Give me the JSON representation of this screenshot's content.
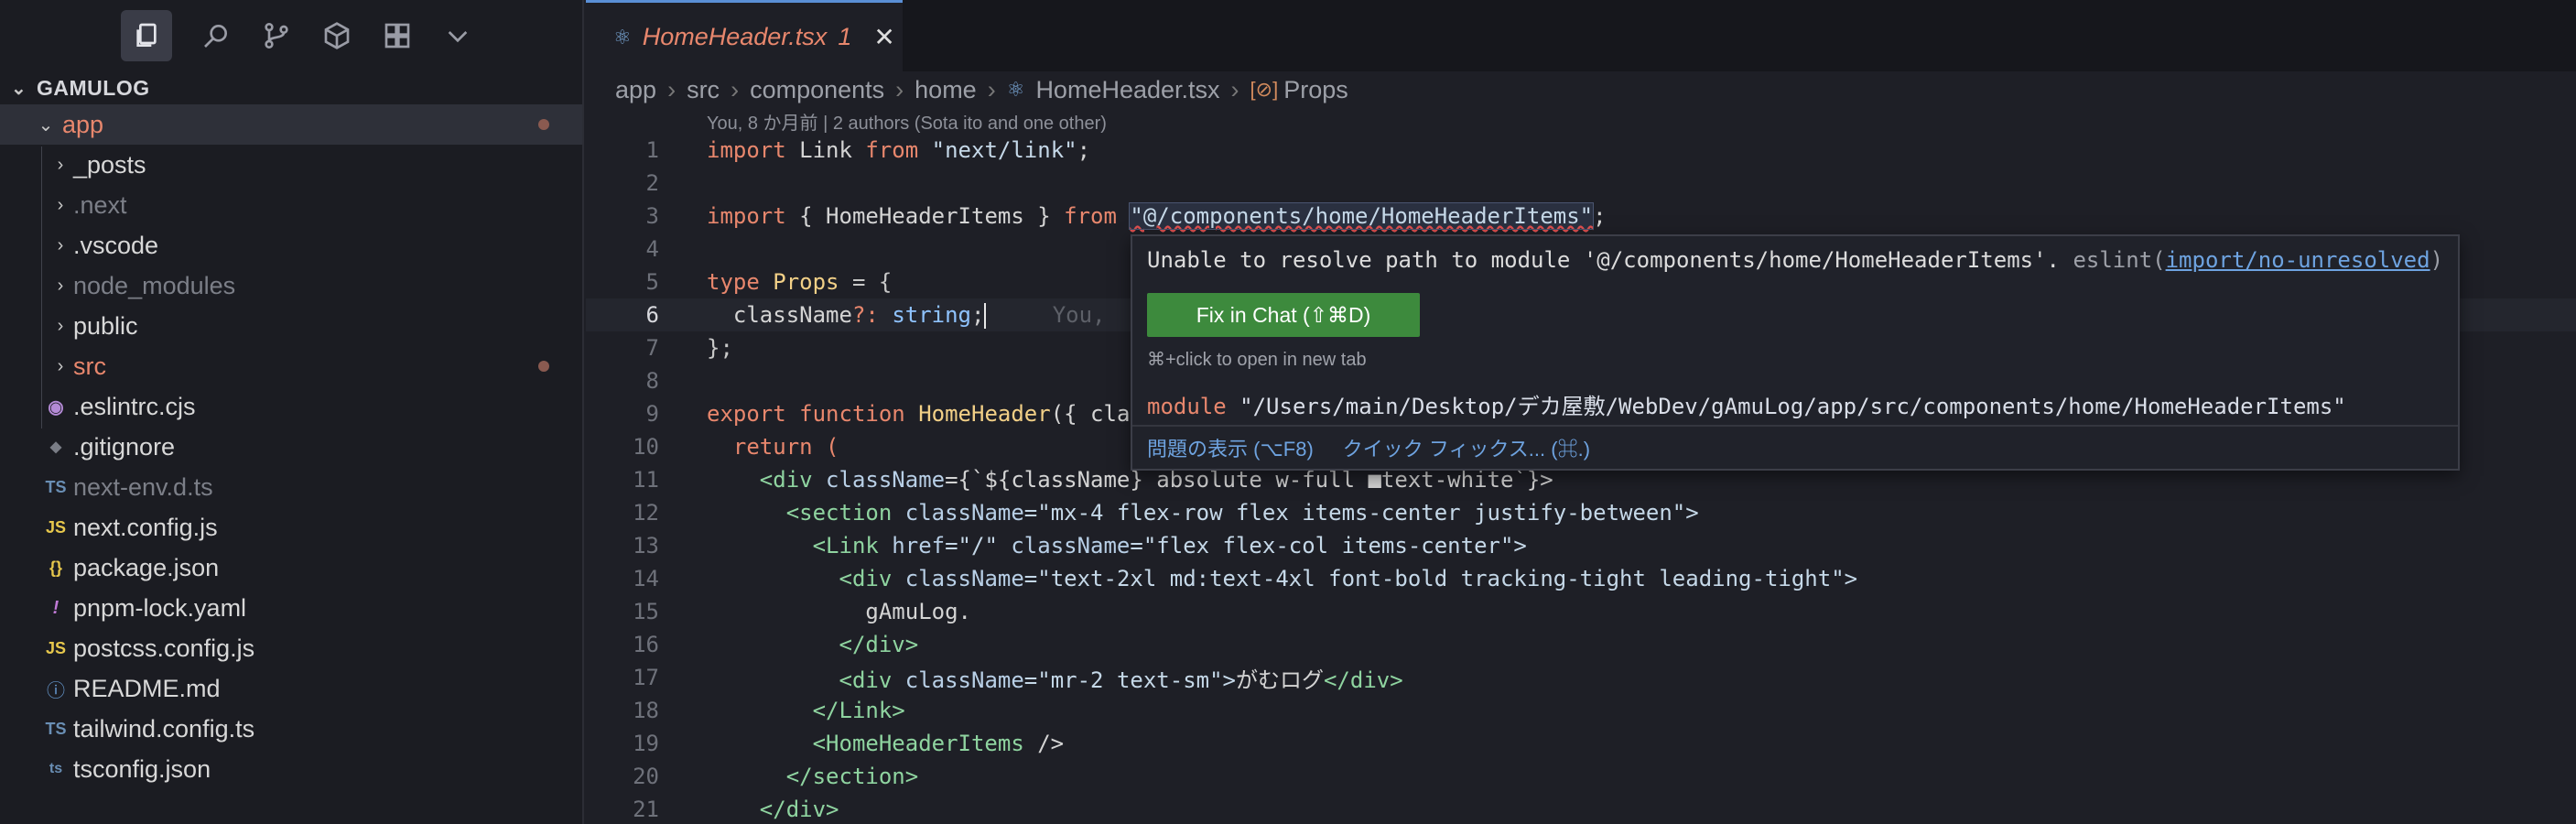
{
  "activity_bar": {
    "icons": [
      "explorer-icon",
      "search-icon",
      "source-control-icon",
      "extensions-cube-icon",
      "extensions-grid-icon",
      "chevron-down-icon"
    ]
  },
  "explorer": {
    "project": "GAMULOG",
    "items": [
      {
        "label": "app",
        "kind": "folder",
        "open": true,
        "state": "error",
        "dot": true
      },
      {
        "label": "_posts",
        "kind": "folder",
        "state": "normal"
      },
      {
        "label": ".next",
        "kind": "folder",
        "state": "dim"
      },
      {
        "label": ".vscode",
        "kind": "folder",
        "state": "normal"
      },
      {
        "label": "node_modules",
        "kind": "folder",
        "state": "dim"
      },
      {
        "label": "public",
        "kind": "folder",
        "state": "normal"
      },
      {
        "label": "src",
        "kind": "folder",
        "state": "error",
        "dot": true
      },
      {
        "label": ".eslintrc.cjs",
        "kind": "file",
        "icon": "◉"
      },
      {
        "label": ".gitignore",
        "kind": "file",
        "icon": "◆"
      },
      {
        "label": "next-env.d.ts",
        "kind": "file",
        "icon": "TS",
        "state": "dim"
      },
      {
        "label": "next.config.js",
        "kind": "file",
        "icon": "JS"
      },
      {
        "label": "package.json",
        "kind": "file",
        "icon": "{}"
      },
      {
        "label": "pnpm-lock.yaml",
        "kind": "file",
        "icon": "!"
      },
      {
        "label": "postcss.config.js",
        "kind": "file",
        "icon": "JS"
      },
      {
        "label": "README.md",
        "kind": "file",
        "icon": "ⓘ"
      },
      {
        "label": "tailwind.config.ts",
        "kind": "file",
        "icon": "TS"
      },
      {
        "label": "tsconfig.json",
        "kind": "file",
        "icon": "ts"
      }
    ]
  },
  "tab": {
    "title": "HomeHeader.tsx",
    "problems": "1"
  },
  "breadcrumb": [
    "app",
    "src",
    "components",
    "home",
    "HomeHeader.tsx",
    "Props"
  ],
  "blame": "You, 8 か月前 | 2 authors (Sota ito and one other)",
  "line_numbers": [
    "1",
    "2",
    "3",
    "4",
    "5",
    "6",
    "7",
    "8",
    "9",
    "10",
    "11",
    "12",
    "13",
    "14",
    "15",
    "16",
    "17",
    "18",
    "19",
    "20",
    "21"
  ],
  "code": {
    "l1_import": "import",
    "l1_link": " Link ",
    "l1_from": "from",
    "l1_str": " \"next/link\"",
    "l1_semi": ";",
    "l3_a": " { HomeHeaderItems } ",
    "l3_str": "\"@/components/home/HomeHeaderItems\"",
    "l5_type": "type",
    "l5_props": " Props ",
    "l5_eq": "= {",
    "l6_name": "  className",
    "l6_q": "?: ",
    "l6_ty": "string",
    "l6_semi": ";",
    "l6_ghost": "     You,",
    "l7": "};",
    "l9_export": "export",
    "l9_function": " function",
    "l9_fn": " HomeHeader",
    "l9_rest": "({ cla",
    "l10": "  return (",
    "l11_tag": "    <div",
    "l11_attr": " className",
    "l11_rest": "={`${className} absolute w-full ■text-white`}>",
    "l12_tag": "      <section",
    "l12_attr": " className",
    "l12_str": "=\"mx-4 flex-row flex items-center justify-between\">",
    "l13_tag": "        <Link",
    "l13_attr": " href",
    "l13_str1": "=\"/\"",
    "l13_attr2": " className",
    "l13_str2": "=\"flex flex-col items-center\">",
    "l14_tag": "          <div",
    "l14_attr": " className",
    "l14_str": "=\"text-2xl md:text-4xl font-bold tracking-tight leading-tight\">",
    "l15": "            gAmuLog.",
    "l16": "          </div>",
    "l17_tag": "          <div",
    "l17_attr": " className",
    "l17_str": "=\"mr-2 text-sm\">",
    "l17_text": "がむログ",
    "l17_end": "</div>",
    "l18": "        </Link>",
    "l19_tag": "        <HomeHeaderItems",
    "l19_end": " />",
    "l20": "      </section>",
    "l21": "    </div>"
  },
  "popup": {
    "message": "Unable to resolve path to module '@/components/home/HomeHeaderItems'.",
    "source": " eslint(",
    "rule": "import/no-unresolved",
    "source_end": ")",
    "fix_button": "Fix in Chat (⇧⌘D)",
    "hint": "⌘+click to open in new tab",
    "module_kw": "module",
    "module_path": " \"/Users/main/Desktop/デカ屋敷/WebDev/gAmuLog/app/src/components/home/HomeHeaderItems\"",
    "view_problem": "問題の表示 (⌥F8)",
    "quick_fix": "クイック フィックス... (⌘.)"
  },
  "colors": {
    "accent": "#5a8fd6",
    "error": "#e8876d",
    "fix_button": "#3d8a3d",
    "link": "#6ea3e0"
  }
}
